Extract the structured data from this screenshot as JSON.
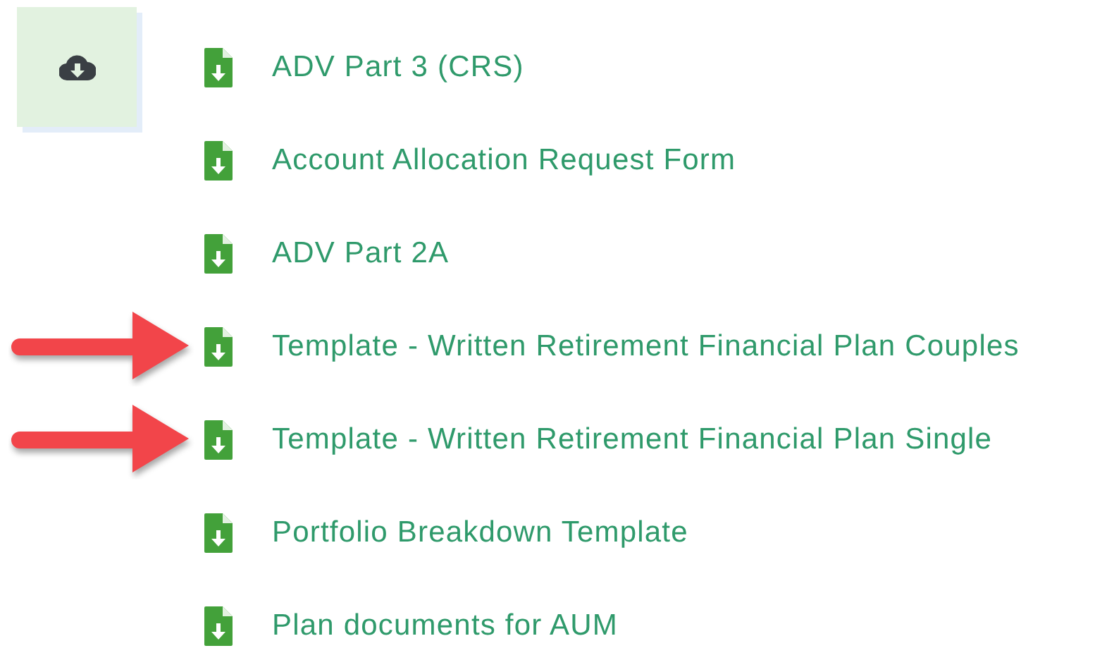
{
  "documents": [
    {
      "label": "ADV Part 3 (CRS)",
      "arrow": false
    },
    {
      "label": "Account Allocation Request Form",
      "arrow": false
    },
    {
      "label": "ADV Part 2A",
      "arrow": false
    },
    {
      "label": "Template - Written Retirement Financial Plan Couples",
      "arrow": true
    },
    {
      "label": "Template - Written Retirement Financial Plan Single",
      "arrow": true
    },
    {
      "label": "Portfolio Breakdown Template",
      "arrow": false
    },
    {
      "label": "Plan documents for AUM",
      "arrow": false
    }
  ]
}
